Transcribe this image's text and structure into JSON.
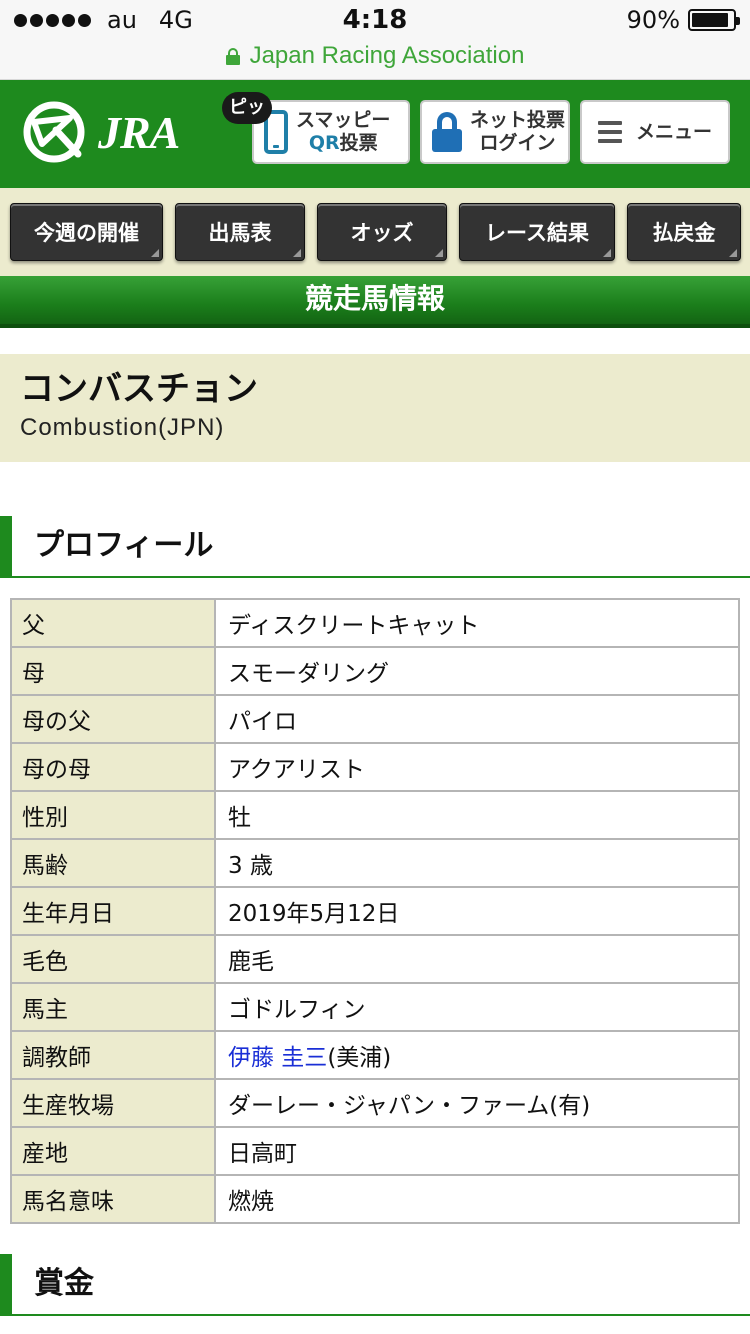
{
  "status_bar": {
    "carrier": "au",
    "network": "4G",
    "time": "4:18",
    "battery": "90%",
    "battery_level": 0.9
  },
  "url_bar": {
    "site": "Japan Racing Association"
  },
  "header": {
    "logo": "JRA",
    "pitt_badge": "ピッ",
    "qr_line1": "スマッピー",
    "qr_line2_a": "QR",
    "qr_line2_b": "投票",
    "login_line1": "ネット投票",
    "login_line2": "ログイン",
    "menu": "メニュー"
  },
  "nav": [
    "今週の開催",
    "出馬表",
    "オッズ",
    "レース結果",
    "払戻金"
  ],
  "banner": "競走馬情報",
  "horse": {
    "name_jp": "コンバスチョン",
    "name_en": "Combustion(JPN)"
  },
  "sections": {
    "profile": "プロフィール",
    "prize": "賞金"
  },
  "profile_rows": [
    {
      "label": "父",
      "value": "ディスクリートキャット"
    },
    {
      "label": "母",
      "value": "スモーダリング"
    },
    {
      "label": "母の父",
      "value": "パイロ"
    },
    {
      "label": "母の母",
      "value": "アクアリスト"
    },
    {
      "label": "性別",
      "value": "牡"
    },
    {
      "label": "馬齢",
      "value": "3 歳"
    },
    {
      "label": "生年月日",
      "value": "2019年5月12日"
    },
    {
      "label": "毛色",
      "value": "鹿毛"
    },
    {
      "label": "馬主",
      "value": "ゴドルフィン"
    },
    {
      "label": "調教師",
      "value_link": "伊藤 圭三",
      "value_suffix": "(美浦)"
    },
    {
      "label": "生産牧場",
      "value": "ダーレー・ジャパン・ファーム(有)"
    },
    {
      "label": "産地",
      "value": "日高町"
    },
    {
      "label": "馬名意味",
      "value": "燃焼"
    }
  ],
  "colors": {
    "brand_green": "#1e8a1e",
    "secure_green": "#3fa63a",
    "cream": "#ecebce",
    "link_blue": "#1a2fd6",
    "qr_blue": "#1f7fa8"
  }
}
